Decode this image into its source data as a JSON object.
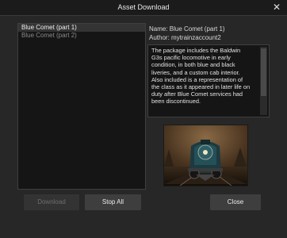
{
  "window": {
    "title": "Asset Download",
    "close_glyph": "✕"
  },
  "list": {
    "items": [
      {
        "label": "Blue Comet (part 1)",
        "selected": true
      },
      {
        "label": "Blue Comet (part 2)",
        "selected": false
      }
    ]
  },
  "details": {
    "name_text": "Name: Blue Comet (part 1)",
    "author_text": "Author: mytrainzaccount2",
    "description": "The package includes the Baldwin G3s pacific locomotive in early condition, in both blue and black liveries, and a custom cab interior. Also included is a representation of the class as it appeared in later life on duty after Blue Comet services had been discontinued."
  },
  "buttons": {
    "download_label": "Download",
    "stop_all_label": "Stop All",
    "close_label": "Close"
  }
}
